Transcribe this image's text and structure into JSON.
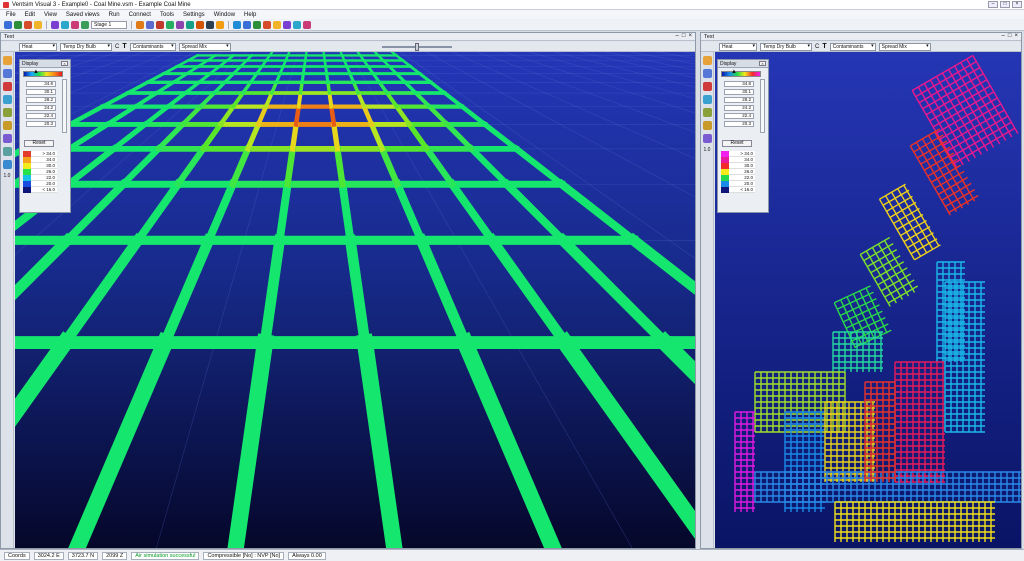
{
  "app": {
    "title": "Ventsim Visual 3 - Example0 - Coal Mine.vsm - Example Coal Mine"
  },
  "window_controls": {
    "minimize": "–",
    "maximize": "□",
    "close": "×"
  },
  "menu": [
    "File",
    "Edit",
    "View",
    "Saved views",
    "Run",
    "Connect",
    "Tools",
    "Settings",
    "Window",
    "Help"
  ],
  "toolbar": {
    "stage_select": "Stage 1",
    "tb_icon_colors": [
      "#3a6fd8",
      "#2d8f3a",
      "#d64b2a",
      "#f0b429",
      "#7a3fd1",
      "#2aa7c9",
      "#c93a77",
      "#3a9e5a",
      "#e07b1a",
      "#5b6ad0",
      "#c0392b",
      "#27ae60",
      "#8e44ad",
      "#16a085",
      "#d35400",
      "#2c3e50",
      "#f39c12",
      "#1f8dd6"
    ]
  },
  "left_pane": {
    "title": "Text",
    "toolbar": {
      "select_1": "Heat",
      "select_2": "Temp Dry Bulb",
      "c_label": "C",
      "t_label": "T",
      "select_3": "Contaminants",
      "select_4": "Spread Mix"
    },
    "side_number": "1.0",
    "display_panel": {
      "title": "Display",
      "values": [
        "34.8",
        "30.1",
        "28.2",
        "24.2",
        "22.4",
        "20.3"
      ],
      "reset_label": "Reset",
      "legend": [
        {
          "color": "#e23b2b",
          "value": "> 34.0"
        },
        {
          "color": "#f3a21a",
          "value": "34.0"
        },
        {
          "color": "#f2ea1a",
          "value": "30.0"
        },
        {
          "color": "#28e24a",
          "value": "26.0"
        },
        {
          "color": "#19c3e8",
          "value": "22.0"
        },
        {
          "color": "#1a4ce0",
          "value": "20.0"
        },
        {
          "color": "#10157a",
          "value": "< 16.0"
        }
      ]
    }
  },
  "right_pane": {
    "title": "Text",
    "toolbar": {
      "select_1": "Heat",
      "select_2": "Temp Dry Bulb",
      "c_label": "C",
      "t_label": "T",
      "select_3": "Contaminants",
      "select_4": "Spread Mix"
    },
    "side_number": "1.0",
    "display_panel": {
      "title": "Display",
      "values": [
        "34.8",
        "30.1",
        "28.2",
        "24.2",
        "22.4",
        "20.3"
      ],
      "reset_label": "Reset",
      "legend": [
        {
          "color": "#f01ff0",
          "value": "> 34.0"
        },
        {
          "color": "#e8199a",
          "value": "34.0"
        },
        {
          "color": "#f22a2a",
          "value": "30.0"
        },
        {
          "color": "#f5ea1a",
          "value": "26.0"
        },
        {
          "color": "#24d94a",
          "value": "22.0"
        },
        {
          "color": "#1a8ae8",
          "value": "20.0"
        },
        {
          "color": "#10157a",
          "value": "< 16.0"
        }
      ]
    }
  },
  "status": {
    "coords_label": "Coords",
    "x": "3024.2 E",
    "y": "3723.7 N",
    "z": "2099 Z",
    "simulation": "Air simulation successful",
    "mode": "Compressible [No] : NVP [No]",
    "extra": "Always 0.00"
  }
}
